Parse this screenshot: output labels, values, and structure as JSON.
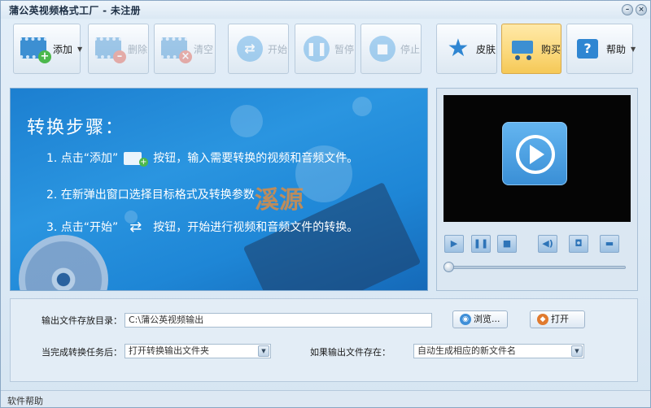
{
  "window": {
    "title": "蒲公英视频格式工厂 - 未注册",
    "minimize_glyph": "–",
    "close_glyph": "×"
  },
  "toolbar": {
    "add": {
      "label": "添加",
      "icon": "film-add-icon",
      "enabled": true
    },
    "delete": {
      "label": "删除",
      "icon": "film-remove-icon",
      "enabled": false
    },
    "clear": {
      "label": "清空",
      "icon": "film-clear-icon",
      "enabled": false
    },
    "start": {
      "label": "开始",
      "icon": "shuffle-icon",
      "enabled": false
    },
    "pause": {
      "label": "暂停",
      "icon": "pause-icon",
      "enabled": false
    },
    "stop": {
      "label": "停止",
      "icon": "stop-icon",
      "enabled": false
    },
    "skin": {
      "label": "皮肤",
      "icon": "star-icon"
    },
    "buy": {
      "label": "购买",
      "icon": "cart-icon"
    },
    "help": {
      "label": "帮助",
      "icon": "help-icon"
    }
  },
  "banner": {
    "title": "转换步骤：",
    "step1_prefix": "1. 点击“添加”",
    "step1_suffix": "按钮，输入需要转换的视频和音频文件。",
    "step2": "2. 在新弹出窗口选择目标格式及转换参数",
    "step3_prefix": "3. 点击“开始”",
    "step3_suffix": "按钮，开始进行视频和音频文件的转换。",
    "watermark": "溪源"
  },
  "player": {
    "controls": [
      "play-icon",
      "pause-icon",
      "stop-icon",
      "volume-icon",
      "camera-icon",
      "fullscreen-icon"
    ],
    "progress": 0
  },
  "settings": {
    "output_dir_label": "输出文件存放目录：",
    "output_dir_value": "C:\\蒲公英视频输出",
    "browse_label": "浏览...",
    "open_label": "打开",
    "after_done_label": "当完成转换任务后：",
    "after_done_value": "打开转换输出文件夹",
    "if_exists_label": "如果输出文件存在：",
    "if_exists_value": "自动生成相应的新文件名"
  },
  "statusbar": {
    "text": "软件帮助"
  },
  "colors": {
    "accent": "#3c8fd2",
    "buy_active": "#fbd87a",
    "banner_blue": "#1e86d6"
  }
}
